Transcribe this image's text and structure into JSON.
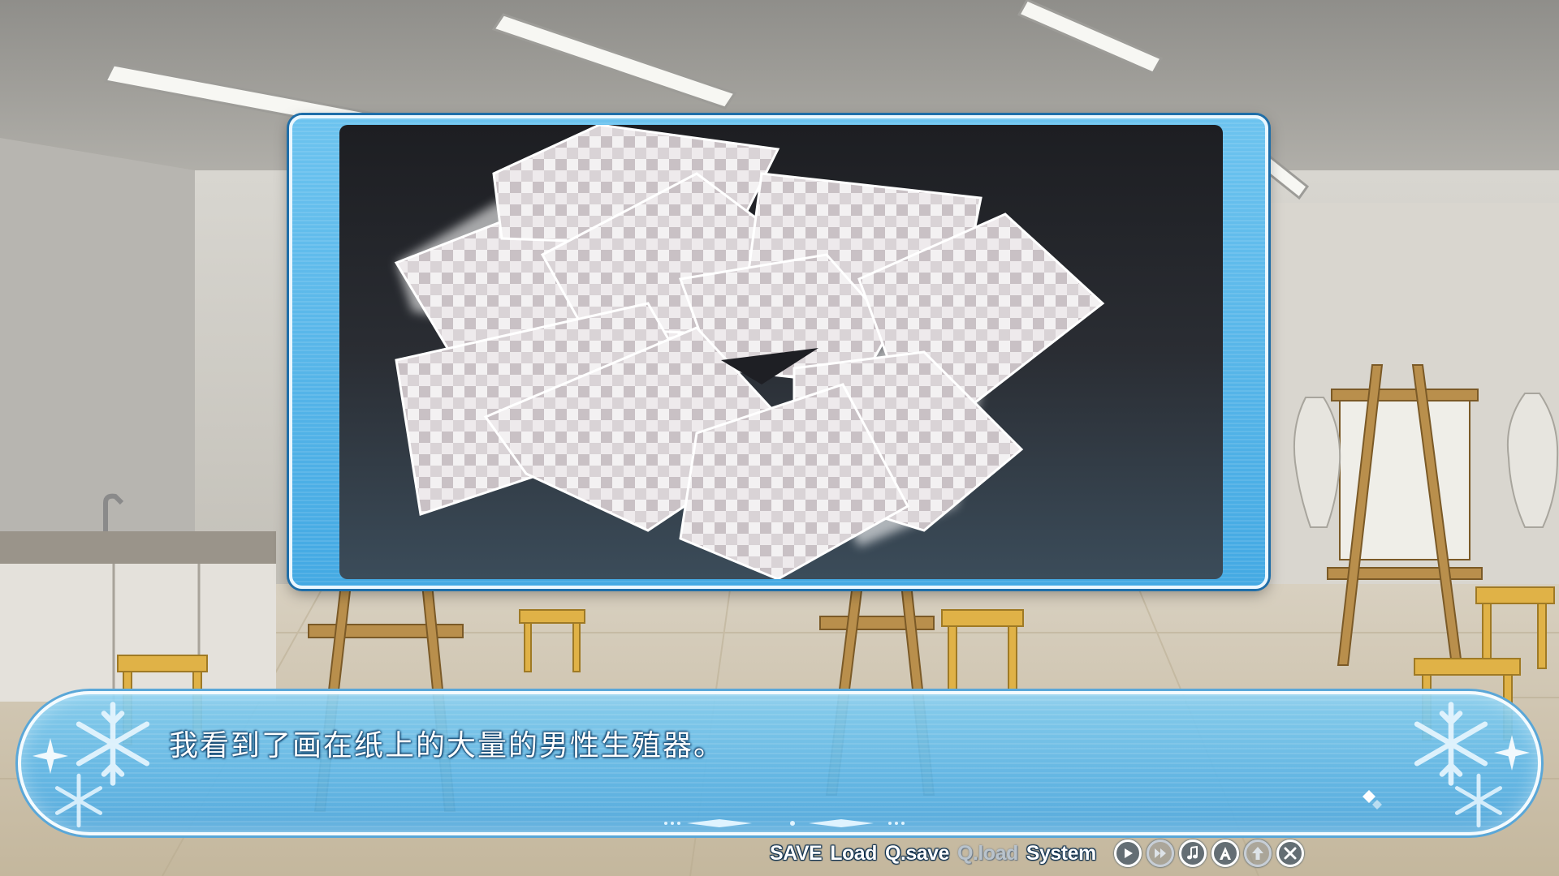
{
  "dialogue": {
    "text": "我看到了画在纸上的大量的男性生殖器。"
  },
  "menu": {
    "save": "SAVE",
    "load": "Load",
    "qsave": "Q.save",
    "qload": "Q.load",
    "system": "System"
  },
  "icons": [
    "auto-play-icon",
    "skip-icon",
    "music-icon",
    "auto-icon",
    "hide-window-icon",
    "close-icon"
  ],
  "colors": {
    "frame_blue": "#43a9e3",
    "dialogue_blue": "#5cb6e8",
    "menu_text": "#ffffff",
    "menu_disabled": "#b9c3cc"
  }
}
